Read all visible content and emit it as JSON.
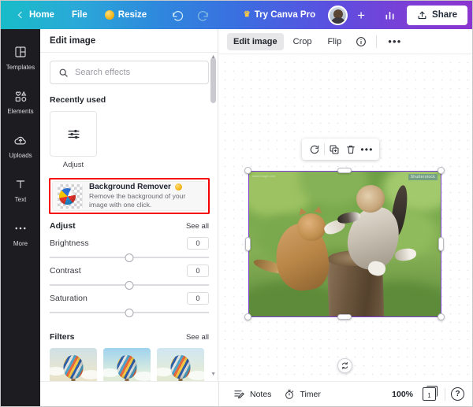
{
  "header": {
    "back_icon": "chevron-left-icon",
    "home_label": "Home",
    "file_label": "File",
    "resize_label": "Resize",
    "resize_icon": "crown-coin-icon",
    "undo_icon": "undo-icon",
    "redo_icon": "redo-icon",
    "try_pro_label": "Try Canva Pro",
    "crown_icon": "crown-icon",
    "avatar_label": "avatar",
    "add_member_label": "+",
    "stats_icon": "bar-chart-icon",
    "share_label": "Share",
    "share_icon": "share-upload-icon"
  },
  "rail": {
    "items": [
      {
        "label": "Templates",
        "icon": "templates-icon"
      },
      {
        "label": "Elements",
        "icon": "elements-icon"
      },
      {
        "label": "Uploads",
        "icon": "uploads-cloud-icon"
      },
      {
        "label": "Text",
        "icon": "text-t-icon"
      },
      {
        "label": "More",
        "icon": "more-dots-icon"
      }
    ]
  },
  "panel": {
    "title": "Edit image",
    "search": {
      "placeholder": "Search effects",
      "icon": "search-icon",
      "value": ""
    },
    "recently_used": {
      "title": "Recently used",
      "items": [
        {
          "label": "Adjust",
          "icon": "sliders-icon"
        }
      ]
    },
    "background_remover": {
      "title": "Background Remover",
      "badge_icon": "pro-crown-icon",
      "description": "Remove the background of your image with one click.",
      "thumb_icon": "beach-ball-transparency-icon"
    },
    "adjust": {
      "title": "Adjust",
      "see_all": "See all",
      "sliders": [
        {
          "name": "Brightness",
          "value": "0"
        },
        {
          "name": "Contrast",
          "value": "0"
        },
        {
          "name": "Saturation",
          "value": "0"
        }
      ]
    },
    "filters": {
      "title": "Filters",
      "see_all": "See all",
      "thumbs": [
        {
          "name": "filter-thumb-1"
        },
        {
          "name": "filter-thumb-2"
        },
        {
          "name": "filter-thumb-3"
        }
      ]
    }
  },
  "context_toolbar": {
    "edit_image_label": "Edit image",
    "crop_label": "Crop",
    "flip_label": "Flip",
    "info_icon": "info-circle-icon",
    "more_label": "•••"
  },
  "object_toolbar": {
    "refresh_icon": "rotate-refresh-icon",
    "duplicate_icon": "duplicate-icon",
    "delete_icon": "trash-icon",
    "more_label": "•••"
  },
  "canvas": {
    "image_alt": "two kittens playing on tree stump",
    "watermark": "Shutterstock",
    "watermark_left": "www.image.com",
    "rotate_icon": "rotate-handle-icon",
    "collapse_icon": "chevron-up-icon",
    "selection_color": "#7b3fd6"
  },
  "bottom_bar": {
    "notes_label": "Notes",
    "notes_icon": "notes-icon",
    "timer_label": "Timer",
    "timer_icon": "timer-clock-icon",
    "zoom_level": "100%",
    "page_number": "1",
    "page_icon": "pages-icon",
    "help_label": "?"
  },
  "colors": {
    "highlight": "#f40000",
    "selection": "#7b3fd6",
    "rail_bg": "#1d1d21"
  }
}
